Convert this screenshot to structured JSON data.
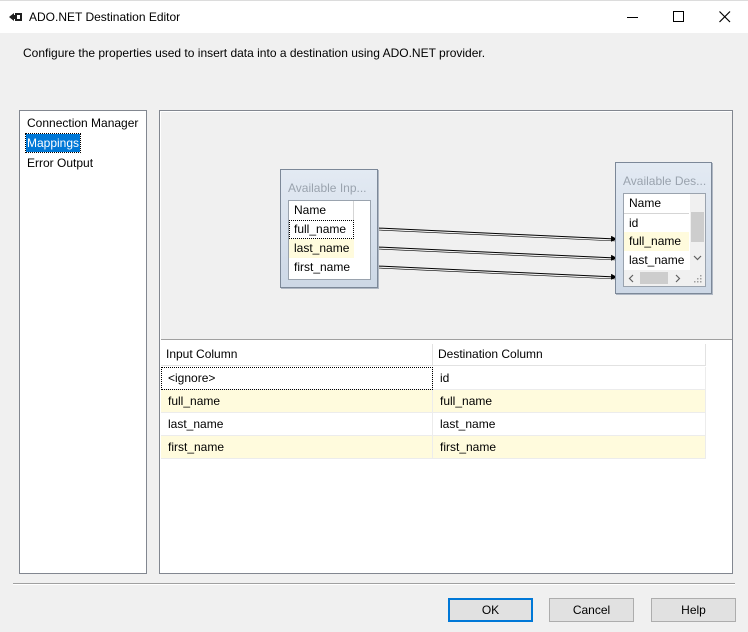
{
  "window": {
    "title": "ADO.NET Destination Editor"
  },
  "description": "Configure the properties used to insert data into a destination using ADO.NET provider.",
  "nav": {
    "items": [
      {
        "label": "Connection Manager"
      },
      {
        "label": "Mappings",
        "selected": true
      },
      {
        "label": "Error Output"
      }
    ]
  },
  "diagram": {
    "input_box": {
      "title": "Available Inp...",
      "header": "Name",
      "columns": [
        "full_name",
        "last_name",
        "first_name"
      ]
    },
    "dest_box": {
      "title": "Available Des...",
      "header": "Name",
      "columns": [
        "id",
        "full_name",
        "last_name"
      ]
    },
    "colors": {
      "box_bg": "#d6dfea",
      "highlight_row": "#fffbdd",
      "mapping_line": "#000000"
    }
  },
  "grid": {
    "headers": {
      "input": "Input Column",
      "destination": "Destination Column"
    },
    "rows": [
      {
        "input": "<ignore>",
        "destination": "id"
      },
      {
        "input": "full_name",
        "destination": "full_name"
      },
      {
        "input": "last_name",
        "destination": "last_name"
      },
      {
        "input": "first_name",
        "destination": "first_name"
      }
    ]
  },
  "buttons": {
    "ok": "OK",
    "cancel": "Cancel",
    "help": "Help"
  },
  "colors": {
    "accent": "#0078d7",
    "window_bg": "#f0f0f0"
  }
}
